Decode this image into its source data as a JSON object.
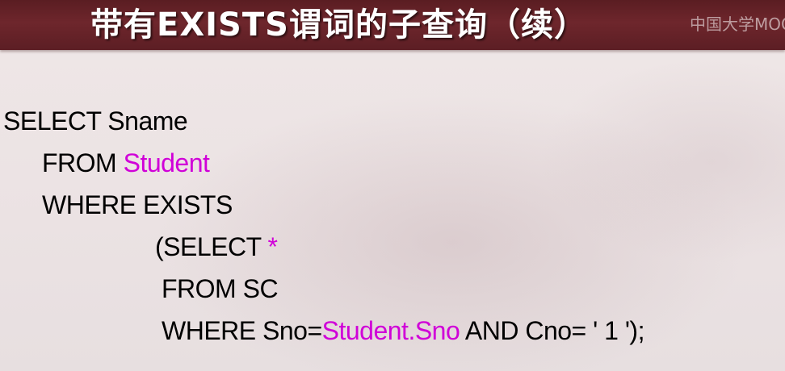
{
  "title": {
    "text": "带有EXISTS谓词的子查询（续）",
    "watermark": "中国大学MOOC"
  },
  "code": {
    "line1": {
      "part1": "SELECT Sname"
    },
    "line2": {
      "part1": "FROM ",
      "part2": "Student"
    },
    "line3": {
      "part1": "WHERE EXISTS"
    },
    "line4": {
      "part1": "(SELECT ",
      "part2": "*"
    },
    "line5": {
      "part1": "FROM SC"
    },
    "line6": {
      "part1": "WHERE Sno=",
      "part2": "Student.Sno",
      "part3": " AND Cno= ' 1 ');"
    }
  },
  "colors": {
    "title_bg": "#5a1d22",
    "title_text": "#ffffff",
    "highlight": "#d000d8",
    "code_text": "#000000",
    "slide_bg": "#ece4e4"
  }
}
